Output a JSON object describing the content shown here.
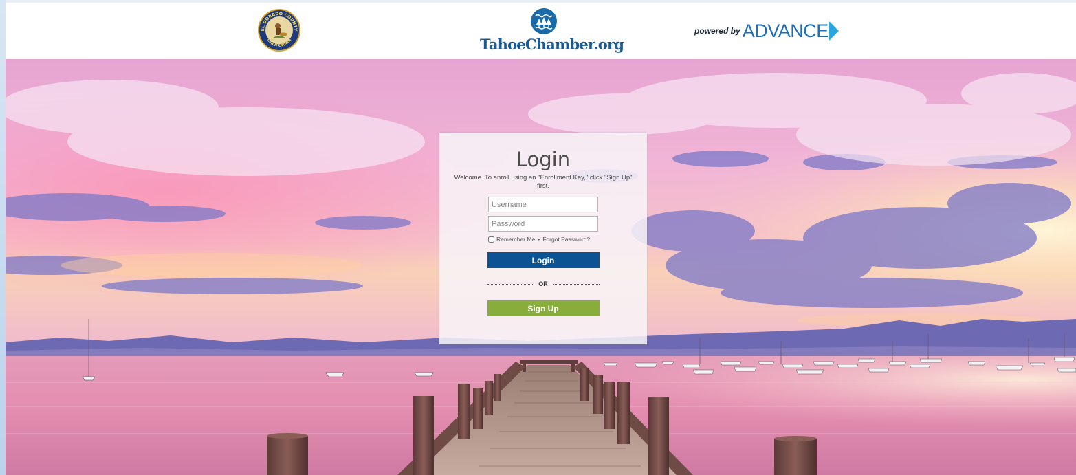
{
  "header": {
    "county_seal": {
      "alt": "El Dorado County California seal",
      "icon": "county-seal-icon",
      "seal_text_top": "EL DORADO COUNTY",
      "seal_text_bottom": "CALIFORNIA"
    },
    "chamber_logo_text": "TahoeChamber.org",
    "powered_by_text": "powered by",
    "advance_text": "ADVANCE",
    "colors": {
      "chamber_blue": "#1a5a96",
      "advance_blue": "#1d6fb8",
      "advance_arrow": "#2aa6e0"
    }
  },
  "background": {
    "description_icon": "lake-pier-sunset-image"
  },
  "login": {
    "title": "Login",
    "welcome": "Welcome. To enroll using an \"Enrollment Key,\" click \"Sign Up\" first.",
    "username_placeholder": "Username",
    "password_placeholder": "Password",
    "remember_label": "Remember Me",
    "separator": "•",
    "forgot_label": "Forgot Password?",
    "login_button": "Login",
    "or_text": "OR",
    "signup_button": "Sign Up",
    "colors": {
      "login_button": "#0c5394",
      "signup_button": "#88ad3b"
    }
  }
}
